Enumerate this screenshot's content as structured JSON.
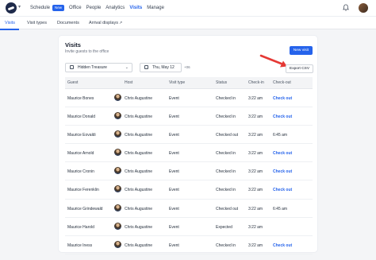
{
  "nav": {
    "items": [
      {
        "label": "Schedule",
        "active": false
      },
      {
        "label": "Office",
        "active": false
      },
      {
        "label": "People",
        "active": false
      },
      {
        "label": "Analytics",
        "active": false
      },
      {
        "label": "Visits",
        "active": true
      },
      {
        "label": "Manage",
        "active": false
      }
    ],
    "new_badge": "New",
    "logo_caret": "▾",
    "icons": [
      "bell-icon",
      "user-avatar"
    ]
  },
  "subtabs": [
    {
      "label": "Visits",
      "active": true
    },
    {
      "label": "Visit types",
      "active": false
    },
    {
      "label": "Documents",
      "active": false
    },
    {
      "label": "Arrival displays",
      "active": false,
      "external_icon": "↗"
    }
  ],
  "card": {
    "title": "Visits",
    "subtitle": "Invite guests to the office",
    "new_visit_label": "New visit",
    "export_label": "Export CSV",
    "location_filter": "Hidden Treasure",
    "date_filter": "Thu, May 12",
    "date_offset": "+06",
    "caret": "⌄"
  },
  "table": {
    "headers": [
      "Guest",
      "Host",
      "Visit type",
      "Status",
      "Check-in",
      "Check-out"
    ],
    "rows": [
      {
        "guest": "Maurice Bones",
        "host": "Chris Augustine",
        "type": "Event",
        "status": "Checked in",
        "check_in": "3:22 am",
        "check_out": "Check out",
        "out_is_link": true
      },
      {
        "guest": "Maurice Donald",
        "host": "Chris Augustine",
        "type": "Event",
        "status": "Checked in",
        "check_in": "3:22 am",
        "check_out": "Check out",
        "out_is_link": true
      },
      {
        "guest": "Maurice Eovaldi",
        "host": "Chris Augustine",
        "type": "Event",
        "status": "Checked out",
        "check_in": "3:22 am",
        "check_out": "6:45 am",
        "out_is_link": false
      },
      {
        "guest": "Maurice Arnold",
        "host": "Chris Augustine",
        "type": "Event",
        "status": "Checked in",
        "check_in": "3:22 am",
        "check_out": "Check out",
        "out_is_link": true
      },
      {
        "guest": "Maurice Cronin",
        "host": "Chris Augustine",
        "type": "Event",
        "status": "Checked in",
        "check_in": "3:22 am",
        "check_out": "Check out",
        "out_is_link": true
      },
      {
        "guest": "Maurice Ferenklin",
        "host": "Chris Augustine",
        "type": "Event",
        "status": "Checked in",
        "check_in": "3:22 am",
        "check_out": "Check out",
        "out_is_link": true
      },
      {
        "guest": "Maurice Grindewald",
        "host": "Chris Augustine",
        "type": "Event",
        "status": "Checked out",
        "check_in": "3:22 am",
        "check_out": "6:45 am",
        "out_is_link": false
      },
      {
        "guest": "Maurice Harold",
        "host": "Chris Augustine",
        "type": "Event",
        "status": "Expected",
        "check_in": "3:22 am",
        "check_out": "",
        "out_is_link": false
      },
      {
        "guest": "Maurice Iness",
        "host": "Chris Augustine",
        "type": "Event",
        "status": "Checked in",
        "check_in": "3:22 am",
        "check_out": "Check out",
        "out_is_link": true
      }
    ]
  },
  "colors": {
    "accent": "#2563eb",
    "arrow": "#e53935"
  }
}
